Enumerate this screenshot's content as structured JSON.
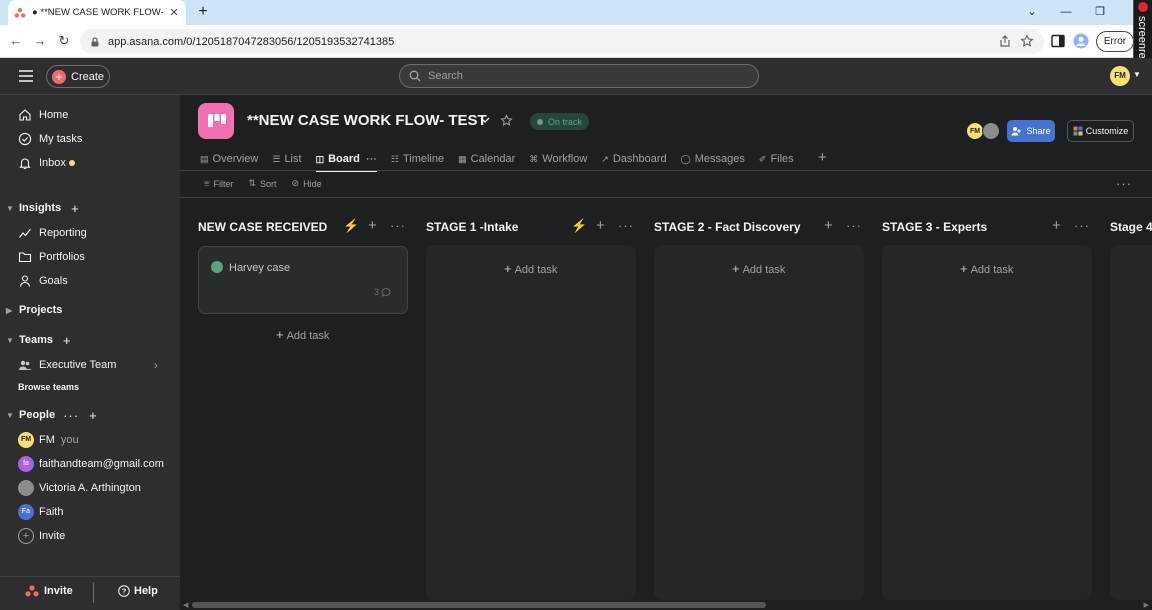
{
  "browser": {
    "tab_title": "● **NEW CASE WORK FLOW- TE",
    "url": "app.asana.com/0/1205187047283056/1205193532741385",
    "error_label": "Error",
    "screenrec_label": "screenrec"
  },
  "topbar": {
    "create_label": "Create",
    "search_placeholder": "Search",
    "avatar_initials": "FM"
  },
  "sidebar": {
    "nav": [
      {
        "label": "Home",
        "icon": "home-icon"
      },
      {
        "label": "My tasks",
        "icon": "check-circle-icon"
      },
      {
        "label": "Inbox",
        "icon": "bell-icon"
      }
    ],
    "insights_label": "Insights",
    "insights_items": [
      {
        "label": "Reporting",
        "icon": "chart-line-icon"
      },
      {
        "label": "Portfolios",
        "icon": "folder-icon"
      },
      {
        "label": "Goals",
        "icon": "person-icon"
      }
    ],
    "projects_label": "Projects",
    "teams_label": "Teams",
    "team_name": "Executive Team",
    "browse_teams": "Browse teams",
    "people_label": "People",
    "people": [
      {
        "initials": "FM",
        "name": "FM",
        "suffix": "you",
        "color": "#f8df72"
      },
      {
        "initials": "fa",
        "name": "faithandteam@gmail.com",
        "suffix": "",
        "color": "#aa62e3"
      },
      {
        "initials": "",
        "name": "Victoria A. Arthington",
        "suffix": "",
        "color": "#8c8c8c"
      },
      {
        "initials": "Fa",
        "name": "Faith",
        "suffix": "",
        "color": "#4573d2"
      }
    ],
    "invite_label": "Invite",
    "footer_invite": "Invite",
    "footer_help": "Help"
  },
  "project": {
    "title": "**NEW CASE WORK FLOW- TEST",
    "status": "On track",
    "share_label": "Share",
    "customize_label": "Customize",
    "member_initials": "FM",
    "tabs": [
      {
        "label": "Overview",
        "icon": "▤"
      },
      {
        "label": "List",
        "icon": "☰"
      },
      {
        "label": "Board",
        "icon": "◫"
      },
      {
        "label": "Timeline",
        "icon": "☷"
      },
      {
        "label": "Calendar",
        "icon": "▦"
      },
      {
        "label": "Workflow",
        "icon": "⌘"
      },
      {
        "label": "Dashboard",
        "icon": "↗"
      },
      {
        "label": "Messages",
        "icon": "◯"
      },
      {
        "label": "Files",
        "icon": "✐"
      }
    ],
    "active_tab": "Board"
  },
  "toolbar": {
    "filter": "Filter",
    "sort": "Sort",
    "hide": "Hide"
  },
  "board": {
    "columns": [
      {
        "title": "NEW CASE RECEIVED",
        "has_rule": true,
        "tasks": [
          {
            "title": "Harvey case",
            "comments": "3"
          }
        ]
      },
      {
        "title": "STAGE 1 -Intake",
        "has_rule": true,
        "tasks": []
      },
      {
        "title": "STAGE 2 - Fact Discovery",
        "has_rule": false,
        "tasks": []
      },
      {
        "title": "STAGE 3 - Experts",
        "has_rule": false,
        "tasks": []
      },
      {
        "title": "Stage 4",
        "has_rule": false,
        "tasks": []
      }
    ],
    "add_task_label": "Add task"
  }
}
